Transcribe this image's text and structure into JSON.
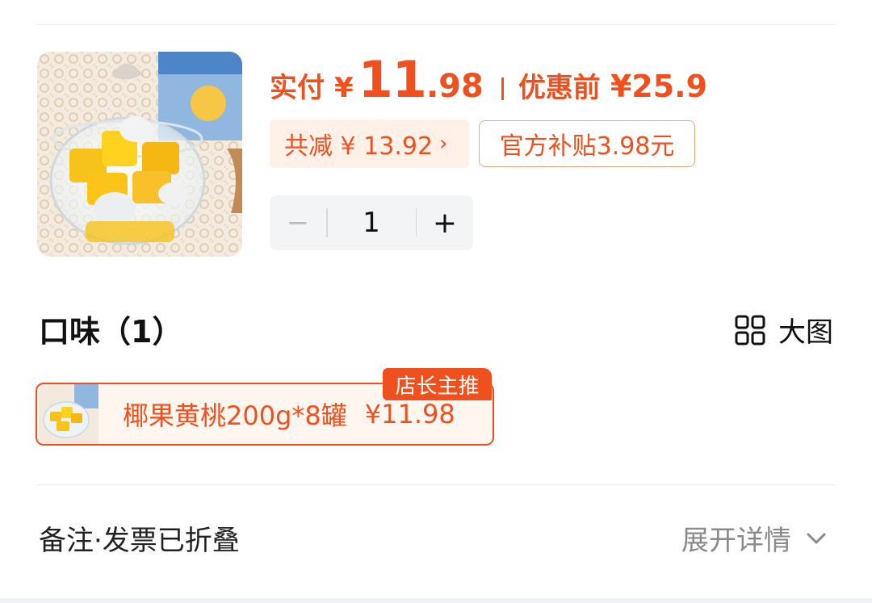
{
  "price": {
    "pay_label": "实付",
    "yen": "¥",
    "pay_int": "11",
    "pay_dec": ".98",
    "before_label": "优惠前",
    "before_value": "¥25.9"
  },
  "discount": {
    "total_label": "共减 ¥ 13.92",
    "subsidy_label": "官方补贴3.98元"
  },
  "stepper": {
    "minus": "−",
    "quantity": "1",
    "plus": "+"
  },
  "flavor": {
    "title": "口味（1）",
    "big_view_label": "大图",
    "options": [
      {
        "name": "椰果黄桃200g*8罐",
        "price": "¥11.98",
        "badge": "店长主推"
      }
    ]
  },
  "remark": {
    "label": "备注·发票已折叠",
    "expand_label": "展开详情"
  },
  "icons": {
    "discount_chevron": "chevron-right-icon",
    "big_view": "grid-icon",
    "expand": "chevron-down-icon"
  },
  "colors": {
    "accent": "#f0501e",
    "discount_bg": "#fff1e8",
    "stepper_bg": "#f2f4f6",
    "muted_text": "#8a8a8a"
  }
}
